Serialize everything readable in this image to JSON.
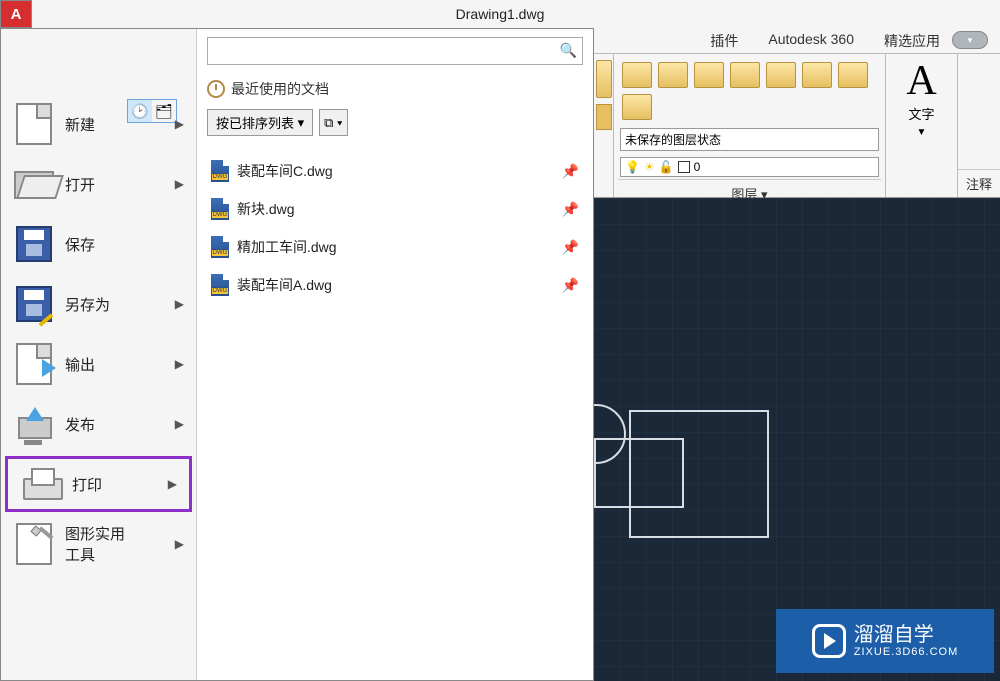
{
  "title": "Drawing1.dwg",
  "ribbon": {
    "tabs": [
      "插件",
      "Autodesk 360",
      "精选应用"
    ],
    "layerPanel": {
      "stateCombo": "未保存的图层状态",
      "currentLayer": "0",
      "label": "图层"
    },
    "textPanel": {
      "big": "A",
      "label": "文字"
    },
    "annotPanel": {
      "label": "注释"
    }
  },
  "appMenu": {
    "items": [
      {
        "label": "新建",
        "key": "new"
      },
      {
        "label": "打开",
        "key": "open"
      },
      {
        "label": "保存",
        "key": "save"
      },
      {
        "label": "另存为",
        "key": "saveas"
      },
      {
        "label": "输出",
        "key": "export"
      },
      {
        "label": "发布",
        "key": "publish"
      },
      {
        "label": "打印",
        "key": "print"
      },
      {
        "label": "图形实用\n工具",
        "key": "tools"
      }
    ],
    "recent": {
      "header": "最近使用的文档",
      "sortLabel": "按已排序列表",
      "docs": [
        {
          "name": "装配车间C.dwg"
        },
        {
          "name": "新块.dwg"
        },
        {
          "name": "精加工车间.dwg"
        },
        {
          "name": "装配车间A.dwg"
        }
      ]
    }
  },
  "watermark": {
    "brand": "溜溜自学",
    "site": "ZIXUE.3D66.COM"
  }
}
